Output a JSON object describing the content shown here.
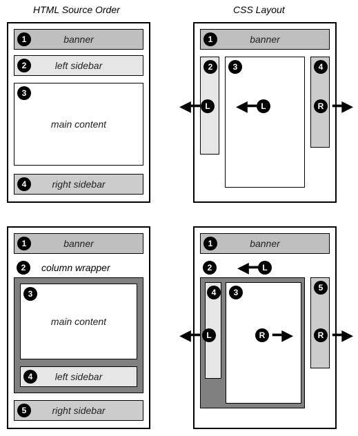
{
  "headers": {
    "left": "HTML Source Order",
    "right": "CSS Layout"
  },
  "top": {
    "source": {
      "b1": {
        "n": "1",
        "label": "banner"
      },
      "b2": {
        "n": "2",
        "label": "left sidebar"
      },
      "b3": {
        "n": "3",
        "label": "main content"
      },
      "b4": {
        "n": "4",
        "label": "right sidebar"
      }
    },
    "css": {
      "banner": {
        "n": "1",
        "label": "banner"
      },
      "sidebarL": {
        "n": "2"
      },
      "main": {
        "n": "3"
      },
      "sidebarR": {
        "n": "4"
      },
      "arrows": {
        "l1": "L",
        "l2": "L",
        "r": "R"
      }
    }
  },
  "bottom": {
    "source": {
      "b1": {
        "n": "1",
        "label": "banner"
      },
      "wrapper": {
        "n": "2",
        "label": "column wrapper"
      },
      "b3": {
        "n": "3",
        "label": "main content"
      },
      "b4": {
        "n": "4",
        "label": "left sidebar"
      },
      "b5": {
        "n": "5",
        "label": "right sidebar"
      }
    },
    "css": {
      "banner": {
        "n": "1",
        "label": "banner"
      },
      "wrapper": {
        "n": "2"
      },
      "main": {
        "n": "3"
      },
      "sidebarL": {
        "n": "4"
      },
      "sidebarR": {
        "n": "5"
      },
      "arrows": {
        "wrapL": "L",
        "l": "L",
        "r1": "R",
        "r2": "R"
      }
    }
  }
}
